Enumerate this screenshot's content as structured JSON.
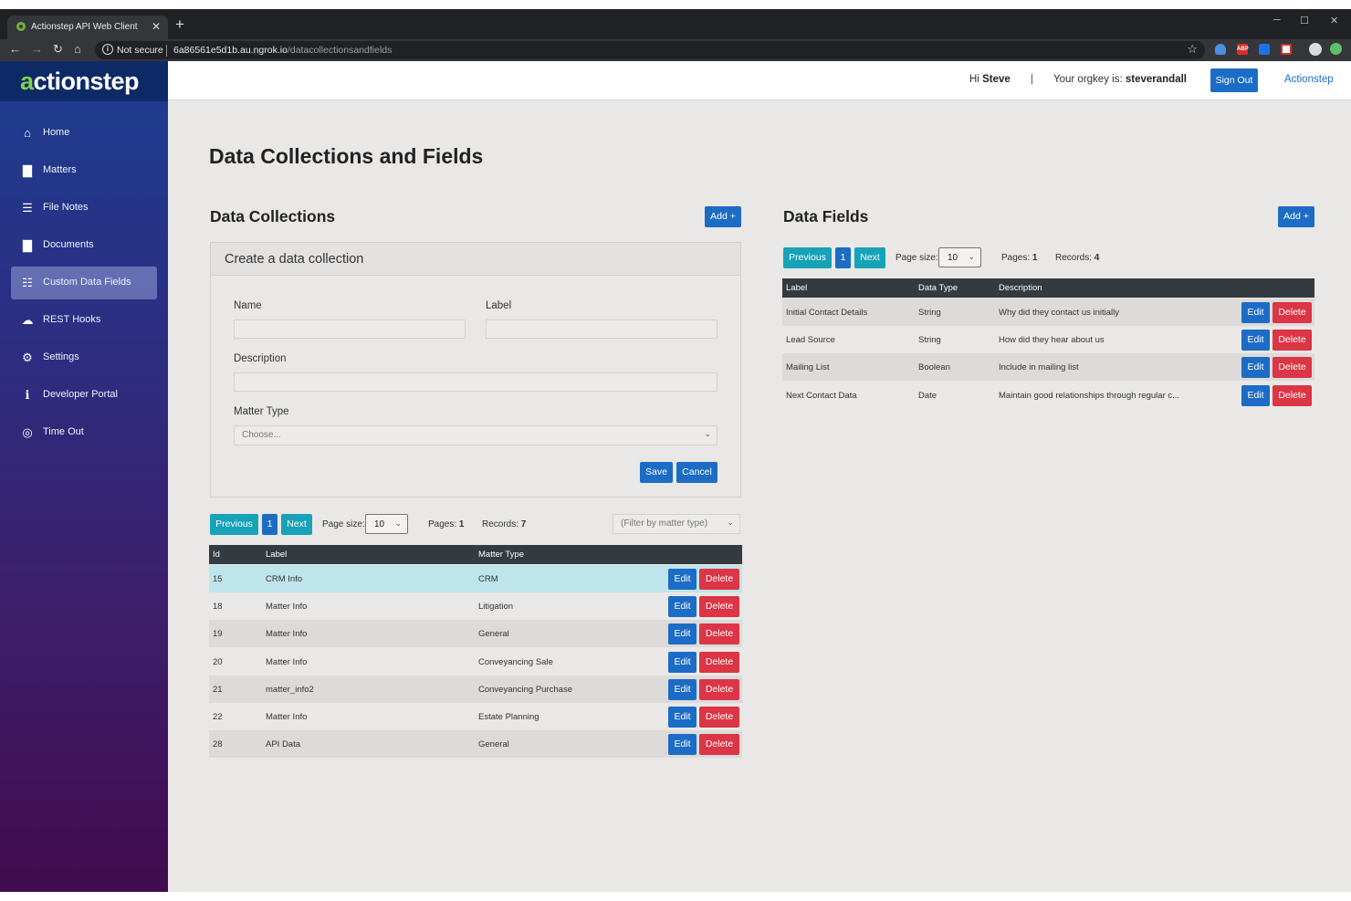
{
  "browser": {
    "tab_title": "Actionstep API Web Client",
    "new_tab": "+",
    "security": "Not secure",
    "url_host": "6a86561e5d1b.au.ngrok.io",
    "url_path": "/datacollectionsandfields",
    "window_controls": [
      "─",
      "☐",
      "✕"
    ]
  },
  "logo": {
    "first": "a",
    "rest": "ctionstep"
  },
  "sidebar": {
    "items": [
      {
        "label": "Home",
        "icon": "home-icon",
        "glyph": "⌂",
        "active": false
      },
      {
        "label": "Matters",
        "icon": "document-icon",
        "glyph": "▇",
        "active": false
      },
      {
        "label": "File Notes",
        "icon": "list-icon",
        "glyph": "☰",
        "active": false
      },
      {
        "label": "Documents",
        "icon": "documents-icon",
        "glyph": "▇",
        "active": false
      },
      {
        "label": "Custom Data Fields",
        "icon": "table-icon",
        "glyph": "☷",
        "active": true
      },
      {
        "label": "REST Hooks",
        "icon": "cloud-icon",
        "glyph": "☁",
        "active": false
      },
      {
        "label": "Settings",
        "icon": "gear-icon",
        "glyph": "⚙",
        "active": false
      },
      {
        "label": "Developer Portal",
        "icon": "info-icon",
        "glyph": "ℹ",
        "active": false
      },
      {
        "label": "Time Out",
        "icon": "target-icon",
        "glyph": "◎",
        "active": false
      }
    ]
  },
  "topbar": {
    "greeting_prefix": "Hi",
    "user": "Steve",
    "divider": "|",
    "orgkey_prefix": "Your orgkey is:",
    "orgkey": "steverandall",
    "sign_out": "Sign Out",
    "actionstep_link": "Actionstep"
  },
  "page": {
    "title": "Data Collections and Fields"
  },
  "collections": {
    "heading": "Data Collections",
    "add_label": "Add +",
    "form": {
      "title": "Create a data collection",
      "name_label": "Name",
      "label_label": "Label",
      "description_label": "Description",
      "matter_type_label": "Matter Type",
      "matter_type_value": "Choose...",
      "save_label": "Save",
      "cancel_label": "Cancel"
    },
    "pager": {
      "previous": "Previous",
      "page": "1",
      "next": "Next",
      "page_size_label": "Page size:",
      "page_size": "10",
      "pages_label": "Pages:",
      "pages": "1",
      "records_label": "Records:",
      "records": "7",
      "filter": "(Filter by matter type)"
    },
    "columns": [
      "Id",
      "Label",
      "Matter Type"
    ],
    "rows": [
      {
        "id": "15",
        "label": "CRM Info",
        "matter_type": "CRM",
        "highlight": true
      },
      {
        "id": "18",
        "label": "Matter Info",
        "matter_type": "Litigation",
        "highlight": false
      },
      {
        "id": "19",
        "label": "Matter Info",
        "matter_type": "General",
        "highlight": false
      },
      {
        "id": "20",
        "label": "Matter Info",
        "matter_type": "Conveyancing Sale",
        "highlight": false
      },
      {
        "id": "21",
        "label": "matter_info2",
        "matter_type": "Conveyancing Purchase",
        "highlight": false
      },
      {
        "id": "22",
        "label": "Matter Info",
        "matter_type": "Estate Planning",
        "highlight": false
      },
      {
        "id": "28",
        "label": "API Data",
        "matter_type": "General",
        "highlight": false
      }
    ],
    "edit_label": "Edit",
    "delete_label": "Delete"
  },
  "fields": {
    "heading": "Data Fields",
    "add_label": "Add +",
    "pager": {
      "previous": "Previous",
      "page": "1",
      "next": "Next",
      "page_size_label": "Page size:",
      "page_size": "10",
      "pages_label": "Pages:",
      "pages": "1",
      "records_label": "Records:",
      "records": "4"
    },
    "columns": [
      "Label",
      "Data Type",
      "Description"
    ],
    "rows": [
      {
        "label": "Initial Contact Details",
        "data_type": "String",
        "description": "Why did they contact us initially"
      },
      {
        "label": "Lead Source",
        "data_type": "String",
        "description": "How did they hear about us"
      },
      {
        "label": "Mailing List",
        "data_type": "Boolean",
        "description": "Include in mailing list"
      },
      {
        "label": "Next Contact Data",
        "data_type": "Date",
        "description": "Maintain good relationships through regular c..."
      }
    ],
    "edit_label": "Edit",
    "delete_label": "Delete"
  },
  "colors": {
    "primary": "#1c6cc6",
    "teal": "#17a2b8",
    "danger": "#dc3545",
    "table_header": "#333a40",
    "row_highlight": "#bee5eb",
    "row_stripe": "#dcdbda"
  }
}
